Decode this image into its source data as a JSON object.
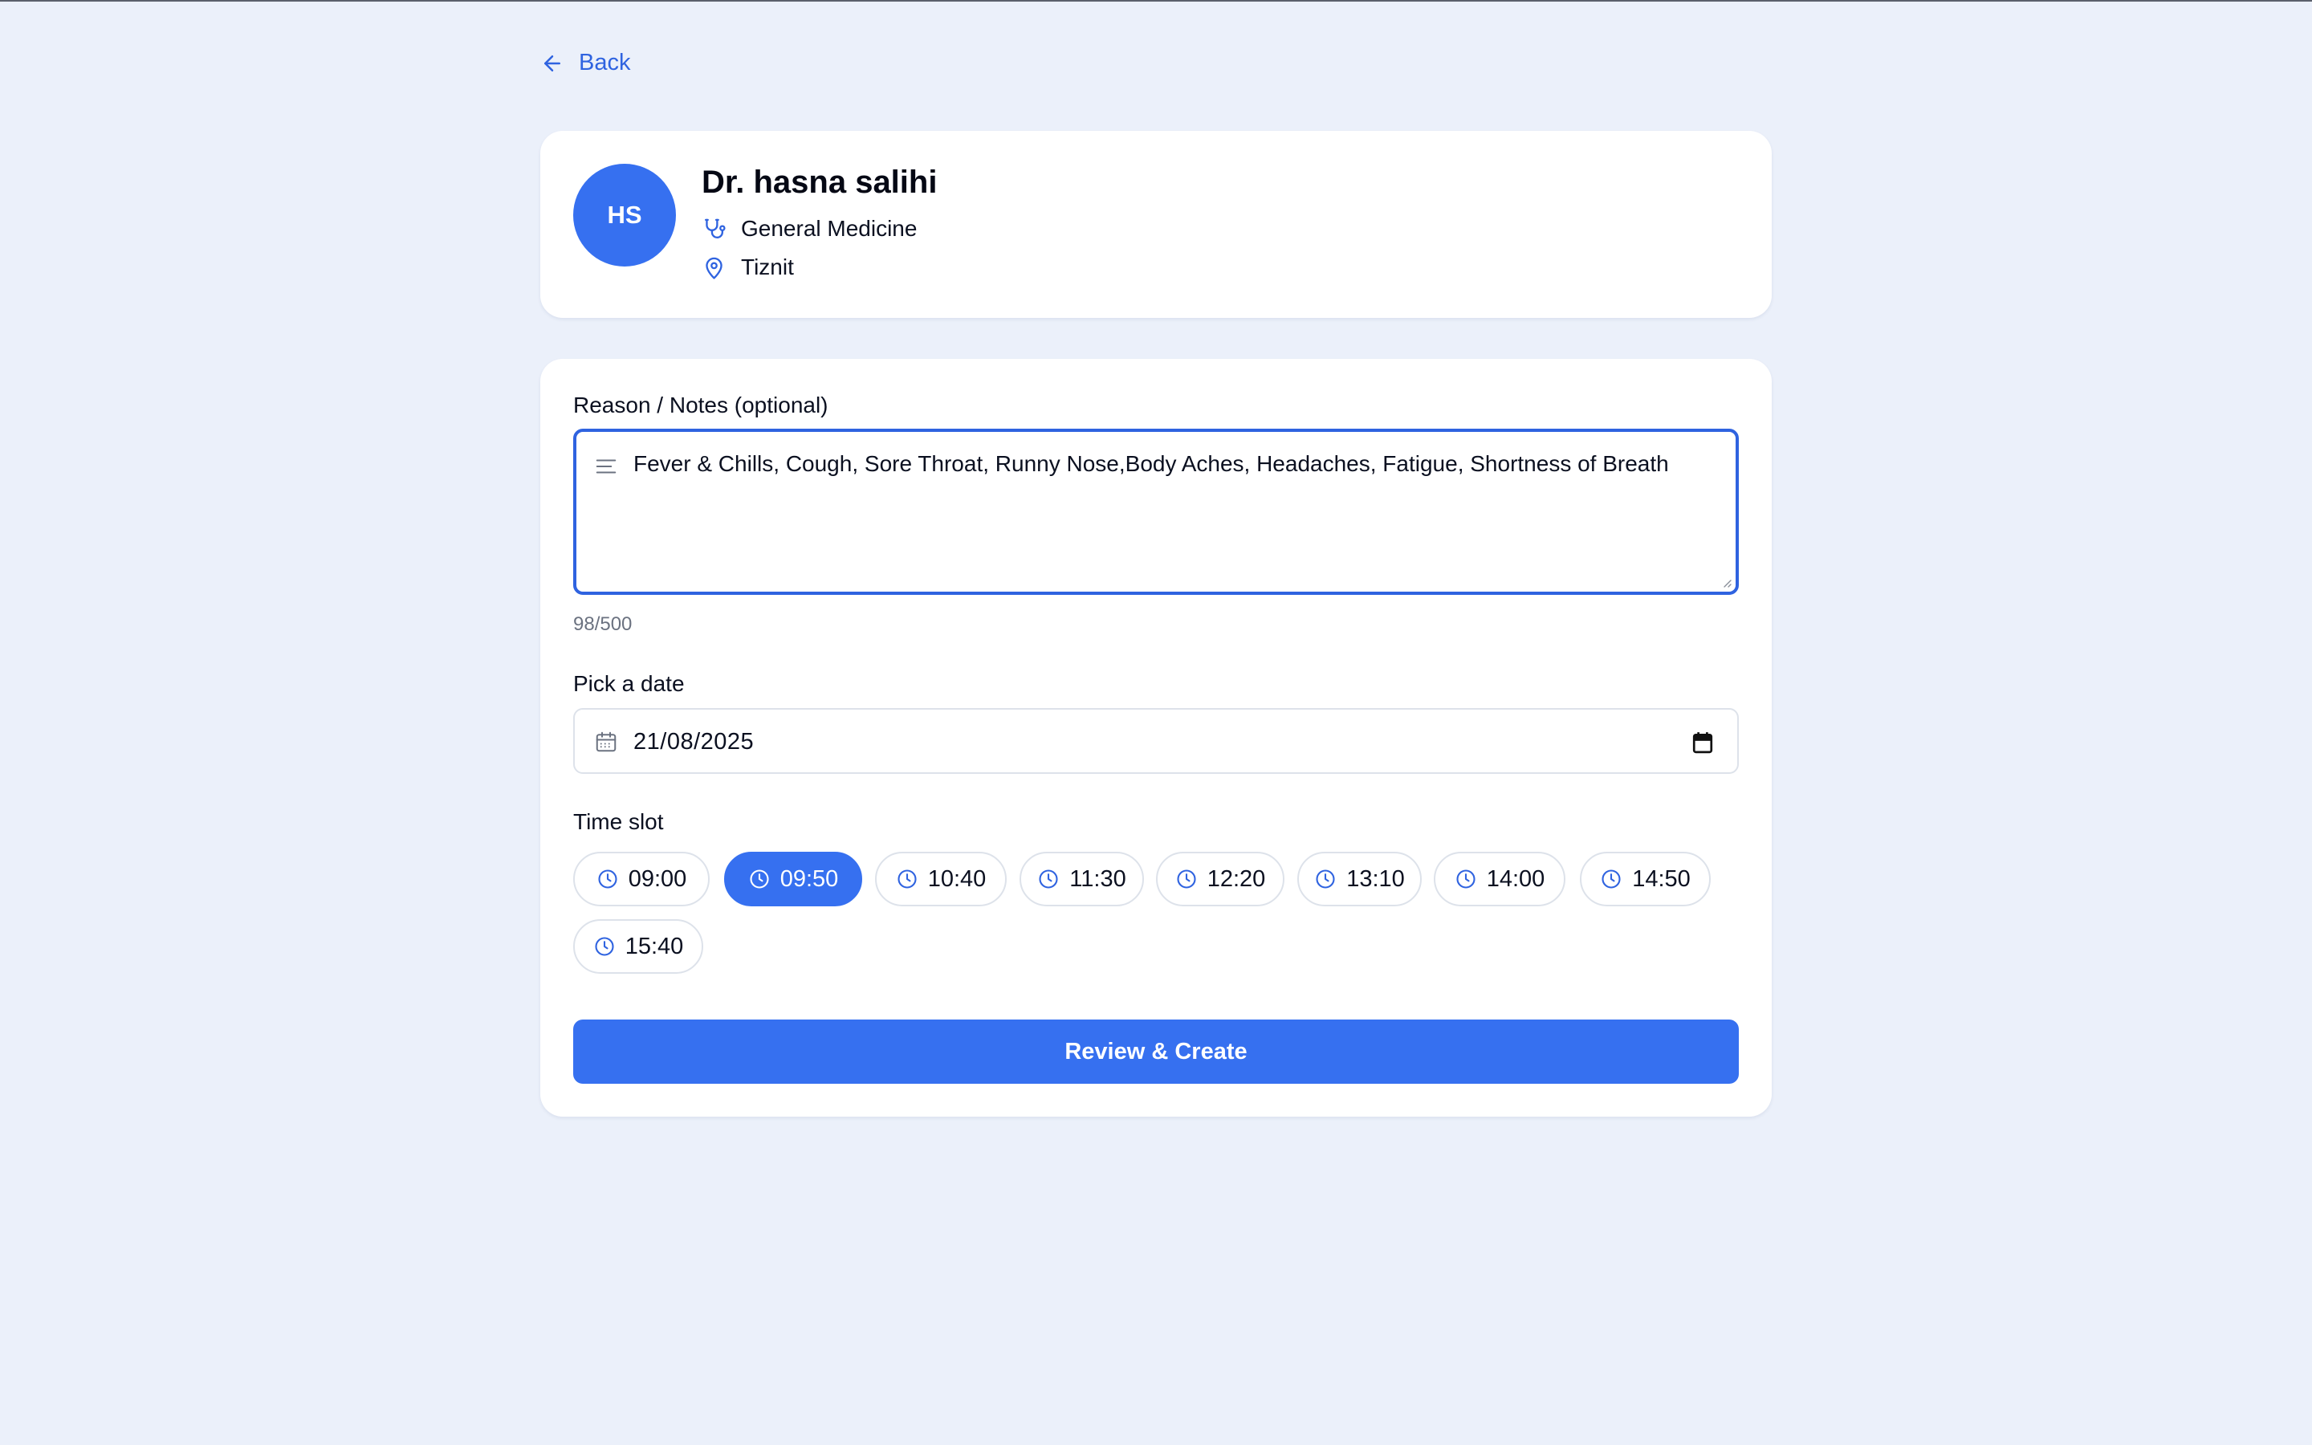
{
  "nav": {
    "back_label": "Back"
  },
  "doctor": {
    "initials": "HS",
    "name": "Dr. hasna salihi",
    "specialty": "General Medicine",
    "location": "Tiznit"
  },
  "form": {
    "reason_label": "Reason / Notes (optional)",
    "reason_value": "Fever & Chills, Cough, Sore Throat, Runny Nose,Body Aches, Headaches, Fatigue, Shortness of Breath",
    "char_counter": "98/500",
    "date_label": "Pick a date",
    "date_value": "21/08/2025",
    "time_label": "Time slot",
    "time_slots": [
      "09:00",
      "09:50",
      "10:40",
      "11:30",
      "12:20",
      "13:10",
      "14:00",
      "14:50",
      "15:40"
    ],
    "selected_slot": "09:50",
    "submit_label": "Review & Create"
  },
  "colors": {
    "accent": "#3670f0",
    "background": "#ebf0fa",
    "card": "#ffffff",
    "border": "#dde2ea"
  },
  "icons": {
    "back": "arrow-left-icon",
    "specialty": "stethoscope-icon",
    "location": "map-pin-icon",
    "notes": "align-left-icon",
    "date": "calendar-icon",
    "time": "clock-icon"
  }
}
